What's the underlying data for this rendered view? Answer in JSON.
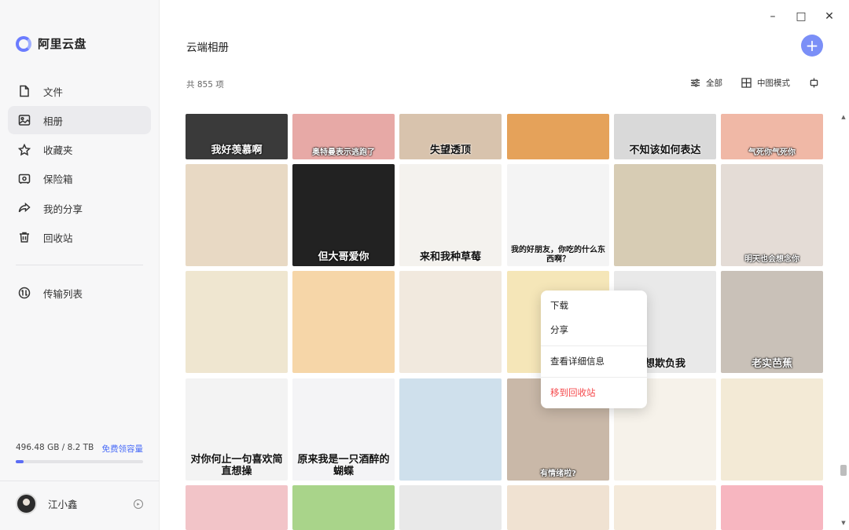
{
  "app": {
    "name": "阿里云盘"
  },
  "window": {
    "minimize": "–",
    "maximize": "□",
    "close": "✕"
  },
  "sidebar": {
    "items": [
      {
        "label": "文件",
        "icon": "file-icon"
      },
      {
        "label": "相册",
        "icon": "photo-icon",
        "active": true
      },
      {
        "label": "收藏夹",
        "icon": "star-icon"
      },
      {
        "label": "保险箱",
        "icon": "safe-icon"
      },
      {
        "label": "我的分享",
        "icon": "share-icon"
      },
      {
        "label": "回收站",
        "icon": "trash-icon"
      }
    ],
    "transfer": {
      "label": "传输列表",
      "icon": "transfer-icon"
    },
    "storage": {
      "used_text": "496.48 GB / 8.2 TB",
      "link": "免费领容量",
      "fraction": 0.059
    },
    "user": {
      "name": "江小鑫"
    }
  },
  "header": {
    "title": "云端相册",
    "add_label": "+",
    "count": "共 855 项",
    "filter_label": "全部",
    "view_label": "中图模式"
  },
  "tiles": [
    {
      "caption": "我好羡慕啊",
      "bg": "#3a3a3a",
      "light": true
    },
    {
      "caption": "奥特曼表示逃跑了",
      "bg": "#e7a9a6",
      "light": true,
      "small": true
    },
    {
      "caption": "失望透顶",
      "bg": "#d8c3ad"
    },
    {
      "caption": "",
      "bg": "#e5a25a"
    },
    {
      "caption": "不知该如何表达",
      "bg": "#d9d9d9"
    },
    {
      "caption": "气死你气死你",
      "bg": "#f0b8a6",
      "light": true,
      "small": true
    },
    {
      "caption": "",
      "bg": "#e8d9c4"
    },
    {
      "caption": "但大哥爱你",
      "bg": "#222222",
      "light": true
    },
    {
      "caption": "来和我种草莓",
      "bg": "#f4f2ee"
    },
    {
      "caption": "我的好朋友，你吃的什么东西啊？",
      "bg": "#f4f4f4",
      "small": true
    },
    {
      "caption": "",
      "bg": "#d7ccb4"
    },
    {
      "caption": "明天也会想念你",
      "bg": "#e4dcd6",
      "light": true,
      "small": true
    },
    {
      "caption": "",
      "bg": "#efe6d0"
    },
    {
      "caption": "",
      "bg": "#f6d6a8"
    },
    {
      "caption": "",
      "bg": "#f1e9de"
    },
    {
      "caption": "",
      "bg": "#f5e6b8"
    },
    {
      "caption": "想欺负我",
      "bg": "#e9e9e9"
    },
    {
      "caption": "老实芭蕉",
      "bg": "#c9c1b8",
      "light": true
    },
    {
      "caption": "对你何止一句喜欢简直想操",
      "bg": "#f3f3f3"
    },
    {
      "caption": "原来我是一只酒醉的蝴蝶",
      "bg": "#f4f4f6"
    },
    {
      "caption": "",
      "bg": "#cfe0ec"
    },
    {
      "caption": "有情绪啦?",
      "bg": "#c9b8a8",
      "light": true,
      "small": true
    },
    {
      "caption": "",
      "bg": "#f6f2ea"
    },
    {
      "caption": "",
      "bg": "#f3ead6"
    },
    {
      "caption": "",
      "bg": "#f2c4c8"
    },
    {
      "caption": "",
      "bg": "#a9d48a"
    },
    {
      "caption": "",
      "bg": "#e9e9e9"
    },
    {
      "caption": "",
      "bg": "#f0e2d2"
    },
    {
      "caption": "",
      "bg": "#f4eadb"
    },
    {
      "caption": "",
      "bg": "#f7b6c0"
    }
  ],
  "context_menu": {
    "download": "下载",
    "share": "分享",
    "details": "查看详细信息",
    "trash": "移到回收站"
  },
  "colors": {
    "accent": "#5b6cf5",
    "danger": "#f5484b"
  }
}
